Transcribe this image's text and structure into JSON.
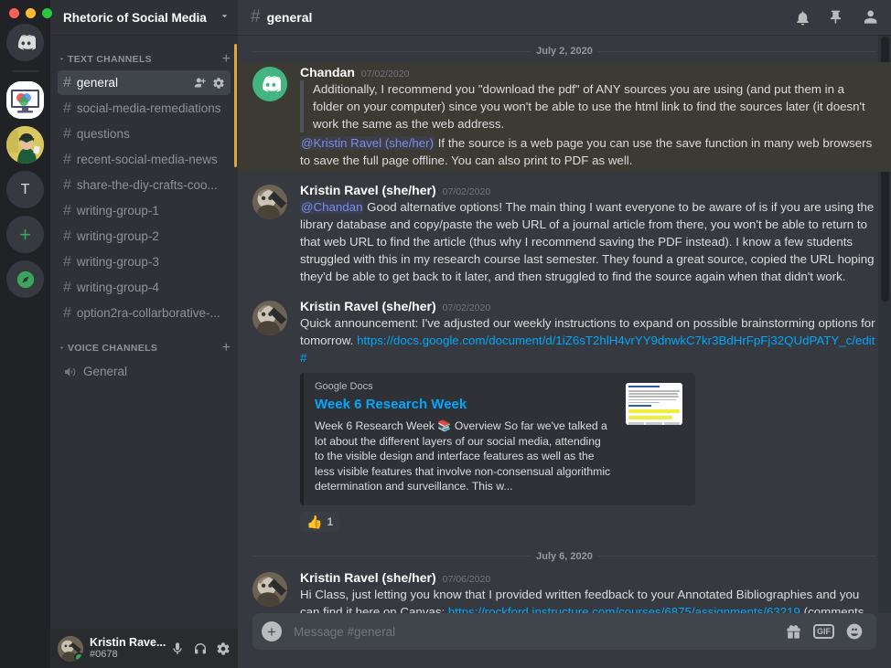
{
  "window": {
    "dots": [
      "close",
      "minimize",
      "maximize"
    ]
  },
  "server_rail": {
    "items": [
      {
        "name": "discord-home",
        "type": "discord-logo",
        "active": false
      },
      {
        "name": "rhetoric-of-social-media",
        "type": "image-classroom",
        "active": true
      },
      {
        "name": "graduation-server",
        "type": "image-graduate",
        "active": false
      },
      {
        "name": "t-server",
        "type": "letter",
        "label": "T",
        "active": false
      },
      {
        "name": "add-server",
        "type": "plus",
        "label": "+",
        "active": false
      },
      {
        "name": "explore-servers",
        "type": "compass",
        "active": false
      }
    ]
  },
  "sidebar": {
    "server_name": "Rhetoric of Social Media",
    "dropdown_icon": "chevron-down-icon",
    "categories": [
      {
        "label": "TEXT CHANNELS",
        "add_icon": "plus-icon",
        "channels": [
          {
            "name": "general",
            "active": true,
            "icons": [
              "add-member-icon",
              "gear-icon"
            ]
          },
          {
            "name": "social-media-remediations",
            "active": false
          },
          {
            "name": "questions",
            "active": false
          },
          {
            "name": "recent-social-media-news",
            "active": false
          },
          {
            "name": "share-the-diy-crafts-coo...",
            "active": false
          },
          {
            "name": "writing-group-1",
            "active": false
          },
          {
            "name": "writing-group-2",
            "active": false
          },
          {
            "name": "writing-group-3",
            "active": false
          },
          {
            "name": "writing-group-4",
            "active": false
          },
          {
            "name": "option2ra-collarborative-...",
            "active": false
          }
        ]
      },
      {
        "label": "VOICE CHANNELS",
        "add_icon": "plus-icon",
        "channels": [
          {
            "name": "General",
            "active": false,
            "voice": true
          }
        ]
      }
    ]
  },
  "user_panel": {
    "username": "Kristin Rave...",
    "discriminator": "#0678",
    "status": "online",
    "icons": [
      "microphone-icon",
      "headphones-icon",
      "gear-icon"
    ]
  },
  "header": {
    "hash": "#",
    "channel": "general",
    "icons": [
      "bell-icon",
      "pin-icon",
      "members-icon"
    ]
  },
  "messages": [
    {
      "divider": "July 2, 2020"
    },
    {
      "author": "Chandan",
      "timestamp": "07/02/2020",
      "avatar": "discord-logo-green",
      "highlighted": true,
      "quote": "Additionally, I recommend you \"download the pdf\" of ANY sources you are using (and put them in a folder on your computer) since you won't be able to use the html link to find the sources later (it doesn't work the same as the web address.",
      "mention": "@Kristin Ravel (she/her)",
      "body": " If the source is a web page you can use the save function in many web browsers to save the full page offline. You can also print to PDF as well."
    },
    {
      "author": "Kristin Ravel (she/her)",
      "timestamp": "07/02/2020",
      "avatar": "photo-kristin",
      "highlighted": false,
      "mention": "@Chandan",
      "body": " Good alternative options! The main thing I want everyone to be aware of is if you are using the library database and copy/paste the web URL of a journal article from there, you won't be able to return to that web URL to find the article (thus why I recommend saving the PDF instead). I know a few students struggled with this in my research course last semester. They found a great source, copied the URL hoping they'd be able to get back to it later, and then struggled to find the source again when that didn't work."
    },
    {
      "author": "Kristin Ravel (she/her)",
      "timestamp": "07/02/2020",
      "avatar": "photo-kristin",
      "highlighted": false,
      "body_pre": "Quick announcement: I've adjusted our weekly instructions to expand on possible brainstorming options for tomorrow. ",
      "link": "https://docs.google.com/document/d/1iZ6sT2hlH4vrYY9dnwkC7kr3BdHrFpFj32QUdPATY_c/edit#",
      "embed": {
        "provider": "Google Docs",
        "title": "Week 6 Research Week",
        "description": "Week 6 Research Week 📚  Overview So far we've talked a lot about the different layers of our social media, attending to the visible design and interface features as well as the less visible features that involve non-consensual algorithmic determination and surveillance. This w...",
        "thumbnail": "document-preview"
      },
      "reaction": {
        "emoji": "👍",
        "count": "1"
      }
    },
    {
      "divider": "July 6, 2020"
    },
    {
      "author": "Kristin Ravel (she/her)",
      "timestamp": "07/06/2020",
      "avatar": "photo-kristin",
      "highlighted": false,
      "body_pre": "Hi Class, just letting you know that I provided written feedback to your Annotated Bibliographies and you can find it here on Canvas: ",
      "link": "https://rockford.instructure.com/courses/6875/assignments/63219",
      "body_post": " (comments should be in the lower right hand side). Please read these over and use it to help you move forward on your research essay drafting! Also please let me know if you have any questions or concerns as you move forward on your project."
    }
  ],
  "composer": {
    "placeholder": "Message #general",
    "value": "",
    "add_icon": "plus-circle-icon",
    "icons": [
      "gift-icon",
      "gif-icon",
      "emoji-icon"
    ],
    "gif_label": "GIF"
  },
  "colors": {
    "accent_blue": "#00a8fc",
    "mention_blue": "#7b8fe0",
    "online_green": "#3ba55d",
    "scrollbar_amber": "#e0a63c",
    "bg_main": "#36393f",
    "bg_sidebar": "#2f3136",
    "bg_rail": "#202225"
  }
}
